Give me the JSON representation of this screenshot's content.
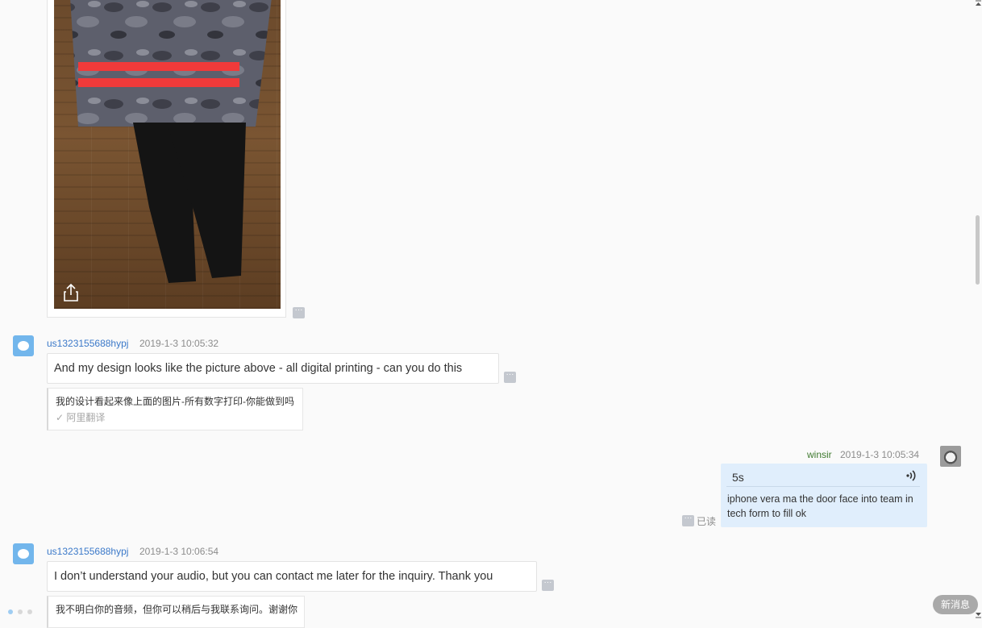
{
  "image_message": {
    "share_icon": "share-icon",
    "more_icon": "more-icon"
  },
  "messages": [
    {
      "sender": "us1323155688hypj",
      "time": "2019-1-3 10:05:32",
      "text": "And my design looks like the picture above - all digital printing - can you do this",
      "translation": "我的设计看起来像上面的图片-所有数字打印-你能做到吗",
      "translation_source": "✓ 阿里翻译"
    },
    {
      "sender": "winsir",
      "time": "2019-1-3 10:05:34",
      "audio_duration": "5s",
      "audio_icon": "audio-wave-icon",
      "transcript": "iphone vera ma the door face into team in tech form to fill ok",
      "status": "已读"
    },
    {
      "sender": "us1323155688hypj",
      "time": "2019-1-3 10:06:54",
      "text": "I don’t understand your audio, but you can contact me later for the inquiry. Thank you",
      "translation": "我不明白你的音频，但你可以稍后与我联系询问。谢谢你"
    }
  ],
  "new_message_button": "新消息",
  "colors": {
    "sender_link": "#3b79c9",
    "self_sender": "#3f7a2f",
    "self_bubble": "#e0eefc",
    "avatar": "#72b6ec"
  }
}
